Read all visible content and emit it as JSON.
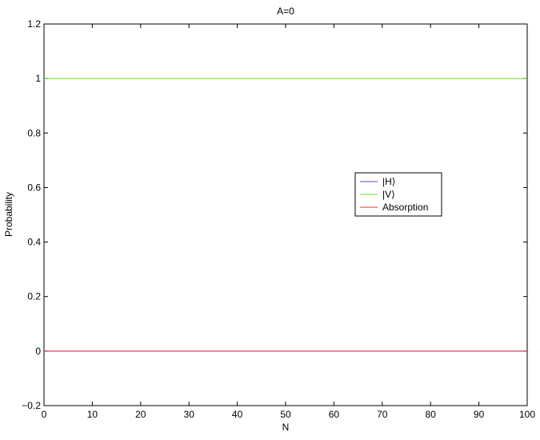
{
  "chart_data": {
    "type": "line",
    "title": "A=0",
    "xlabel": "N",
    "ylabel": "Probability",
    "xlim": [
      0,
      100
    ],
    "ylim": [
      -0.2,
      1.2
    ],
    "xticks": [
      0,
      10,
      20,
      30,
      40,
      50,
      60,
      70,
      80,
      90,
      100
    ],
    "xtick_labels": [
      "0",
      "10",
      "20",
      "30",
      "40",
      "50",
      "60",
      "70",
      "80",
      "90",
      "100"
    ],
    "yticks": [
      -0.2,
      0,
      0.2,
      0.4,
      0.6,
      0.8,
      1,
      1.2
    ],
    "ytick_labels": [
      "−0.2",
      "0",
      "0.2",
      "0.4",
      "0.6",
      "0.8",
      "1",
      "1.2"
    ],
    "grid": false,
    "legend_position": "right",
    "series": [
      {
        "name": "|H⟩",
        "color": "#4a4aff",
        "x": [
          0,
          100
        ],
        "y": [
          0,
          0
        ]
      },
      {
        "name": "|V⟩",
        "color": "#66dd22",
        "x": [
          0,
          100
        ],
        "y": [
          1,
          1
        ]
      },
      {
        "name": "Absorption",
        "color": "#ff2a2a",
        "x": [
          0,
          100
        ],
        "y": [
          0,
          0
        ]
      }
    ]
  }
}
